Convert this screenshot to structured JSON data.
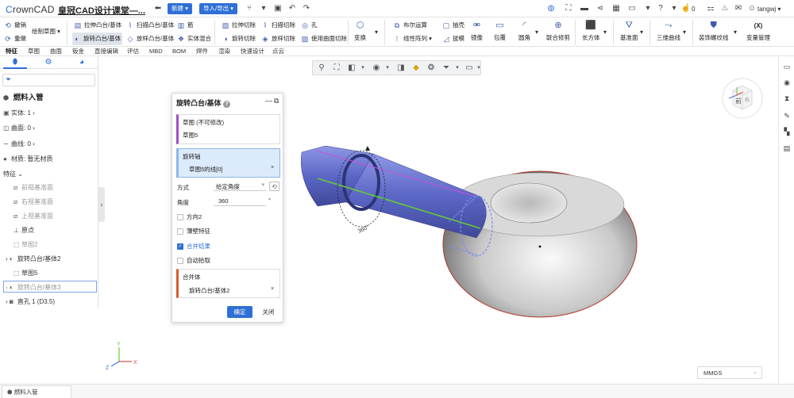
{
  "app": {
    "logo_accent": "C",
    "logo_rest": "rownCAD",
    "doc_title": "皇冠CAD设计课堂—..."
  },
  "topbar": {
    "new_label": "新建",
    "import_export_label": "导入/导出",
    "likes": "0",
    "user": "tangwj",
    "icons": [
      "back-icon",
      "branch-icon",
      "save-icon",
      "undo-icon",
      "redo-icon",
      "globe-icon",
      "fullscreen-icon",
      "screen-icon",
      "share-icon",
      "layout-icon",
      "monitor-icon",
      "help-icon",
      "like-icon",
      "bell-icon",
      "user-icon"
    ]
  },
  "ribbon": {
    "undo": "撤销",
    "redo": "重做",
    "sketch": "绘制草图",
    "extrude": "拉伸凸台/基体",
    "sweep": "扫描凸台/基体",
    "rib": "筋",
    "extrude_cut": "拉伸切除",
    "sweep_cut": "扫描切除",
    "hole": "孔",
    "revolve": "旋转凸台/基体",
    "loft": "放样凸台/基体",
    "solid_mix": "实体混合",
    "revolve_cut": "旋转切除",
    "loft_cut": "放样切除",
    "surface_cut": "使用曲面切除",
    "transform": "变换",
    "boolean": "布尔运算",
    "pattern": "线性阵列",
    "shell": "抽壳",
    "draft": "拔模",
    "mirror": "镜像",
    "wrap": "包覆",
    "fillet": "圆角",
    "combine_trim": "联合修剪",
    "box": "长方体",
    "ref_plane": "基准面",
    "curve3d": "三维曲线",
    "thread": "装饰螺纹线",
    "variables": "变量管理",
    "variables_icon": "(X)"
  },
  "menu": [
    "特征",
    "草图",
    "曲面",
    "钣金",
    "直接编辑",
    "评估",
    "MBD",
    "BOM",
    "焊件",
    "渲染",
    "快速设计",
    "点云"
  ],
  "tree": {
    "part_name": "燃料入管",
    "solids": "实体: 1",
    "surfaces": "曲面: 0",
    "curves": "曲线: 0",
    "material": "材质: 暂无材质",
    "features_label": "特征",
    "items": [
      "前视基准面",
      "右视基准面",
      "上视基准面",
      "原点",
      "草图2",
      "旋转凸台/基体2",
      "草图5",
      "旋转凸台/基体3",
      "直孔 1 (D3.5)"
    ]
  },
  "dialog": {
    "title": "旋转凸台/基体",
    "sketch_label": "草图 (不可修改)",
    "sketch_value": "草图5",
    "axis_label": "旋转轴",
    "axis_value": "草图5的线[0]",
    "method_label": "方式",
    "method_value": "给定角度",
    "angle_label": "角度",
    "angle_value": "360",
    "angle_unit": "°",
    "dir2": "方向2",
    "thin": "薄壁特征",
    "merge": "合并结果",
    "auto_pick": "自动拾取",
    "merge_body_label": "合并体",
    "merge_body_value": "旋转凸台/基体2",
    "ok": "确定",
    "close": "关闭"
  },
  "viewport": {
    "dimension": "360°",
    "units": "MMGS",
    "viewcube_front": "前",
    "viewcube_right": "右",
    "axis_x": "X",
    "axis_y": "Y",
    "axis_z": "Z"
  },
  "bottom": {
    "tab": "燃料入管"
  },
  "colors": {
    "accent": "#2f6fd6",
    "body_blue": "#5b66c2",
    "axis_green": "#66cc33"
  }
}
